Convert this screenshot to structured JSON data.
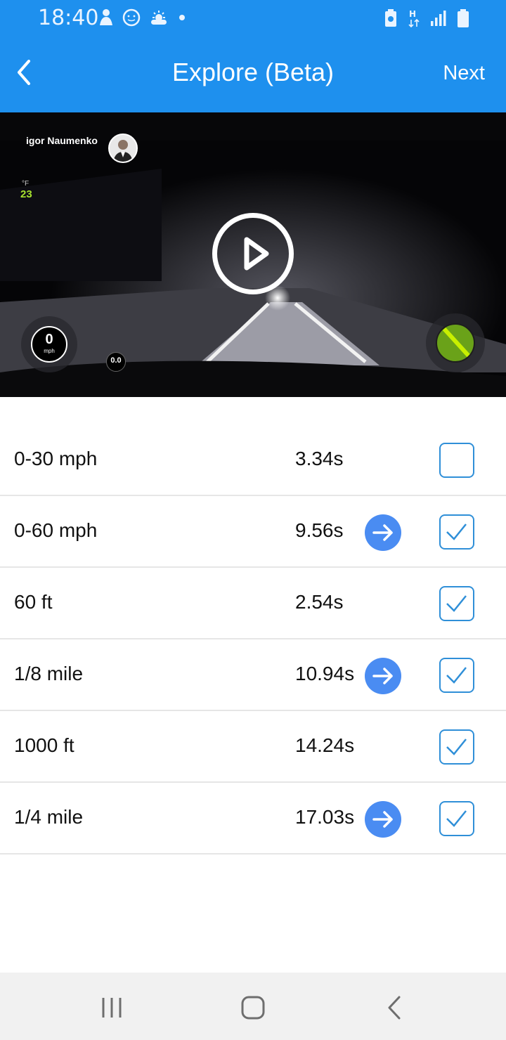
{
  "status_bar": {
    "time": "18:40",
    "left_icons": [
      "person-icon",
      "smile-icon",
      "weather-icon",
      "dot-icon"
    ],
    "right_icons": [
      "battery-saver-icon",
      "h-plus-data-icon",
      "signal-icon",
      "battery-icon"
    ]
  },
  "app_bar": {
    "title": "Explore (Beta)",
    "next_label": "Next",
    "back_icon": "chevron-left-icon"
  },
  "video": {
    "driver_name": "igor Naumenko",
    "temperature_unit": "°F",
    "temperature": "23",
    "speed": "0",
    "speed_unit": "mph",
    "gforce": "0.0",
    "play_icon": "play-icon",
    "accent_color": "#6aa219"
  },
  "results": [
    {
      "label": "0-30 mph",
      "time": "3.34s",
      "has_arrow": false,
      "checked": false
    },
    {
      "label": "0-60 mph",
      "time": "9.56s",
      "has_arrow": true,
      "checked": true
    },
    {
      "label": "60 ft",
      "time": "2.54s",
      "has_arrow": false,
      "checked": true
    },
    {
      "label": "1/8 mile",
      "time": "10.94s",
      "has_arrow": true,
      "checked": true
    },
    {
      "label": "1000 ft",
      "time": "14.24s",
      "has_arrow": false,
      "checked": true
    },
    {
      "label": "1/4 mile",
      "time": "17.03s",
      "has_arrow": true,
      "checked": true
    }
  ],
  "nav_bar": {
    "icons": [
      "recent-apps-icon",
      "home-icon",
      "back-icon"
    ]
  },
  "colors": {
    "primary": "#1e90ee",
    "arrow_button": "#4a8cf2",
    "checkbox": "#2f8fd8"
  }
}
